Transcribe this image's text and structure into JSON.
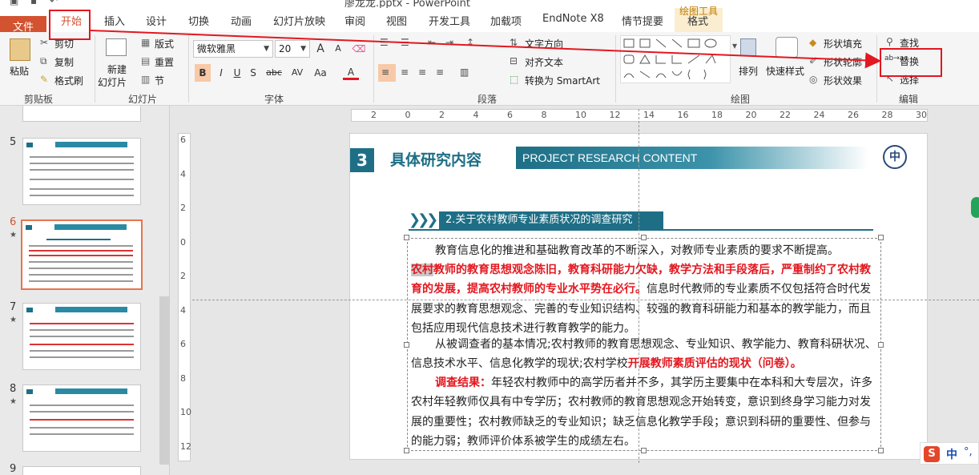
{
  "window": {
    "title": "廖龙龙.pptx - PowerPoint"
  },
  "tabs": {
    "file": "文件",
    "home": "开始",
    "insert": "插入",
    "design": "设计",
    "transitions": "切换",
    "animations": "动画",
    "slideshow": "幻灯片放映",
    "review": "审阅",
    "view": "视图",
    "developer": "开发工具",
    "addins": "加载项",
    "endnote": "EndNote X8",
    "storyboard": "情节提要",
    "format": "格式",
    "drawing_tools": "绘图工具"
  },
  "clipboard": {
    "paste": "粘贴",
    "cut": "剪切",
    "copy": "复制",
    "format_painter": "格式刷",
    "label": "剪贴板"
  },
  "slides": {
    "new_slide_1": "新建",
    "new_slide_2": "幻灯片",
    "layout": "版式",
    "reset": "重置",
    "section": "节",
    "label": "幻灯片"
  },
  "font": {
    "name": "微软雅黑",
    "size": "20",
    "label": "字体",
    "bold": "B",
    "italic": "I",
    "underline": "U",
    "shadow": "S",
    "strike": "abc",
    "spacing": "AV",
    "case": "Aa",
    "color": "A",
    "grow": "A",
    "shrink": "A"
  },
  "paragraph": {
    "text_direction": "文字方向",
    "align_text": "对齐文本",
    "smartart": "转换为 SmartArt",
    "label": "段落"
  },
  "drawing": {
    "arrange": "排列",
    "quick_styles": "快速样式",
    "shape_fill": "形状填充",
    "shape_outline": "形状轮廓",
    "shape_effects": "形状效果",
    "label": "绘图"
  },
  "editing": {
    "find": "查找",
    "replace": "替换",
    "select": "选择",
    "label": "编辑"
  },
  "thumbnails": [
    {
      "num": "5"
    },
    {
      "num": "6",
      "star": "★"
    },
    {
      "num": "7",
      "star": "★"
    },
    {
      "num": "8",
      "star": "★"
    },
    {
      "num": "9"
    }
  ],
  "ruler": {
    "h": [
      "2",
      "0",
      "2",
      "4",
      "6",
      "8",
      "10",
      "12",
      "14",
      "16",
      "18",
      "20",
      "22",
      "24",
      "26",
      "28",
      "30"
    ],
    "v": [
      "6",
      "4",
      "2",
      "0",
      "2",
      "4",
      "6",
      "8",
      "10",
      "12"
    ]
  },
  "slide": {
    "section_number": "3",
    "section_title": "具体研究内容",
    "band_text": "PROJECT RESEARCH CONTENT",
    "subhead": "2.关于农村教师专业素质状况的调查研究",
    "p1": "教育信息化的推进和基础教育改革的不断深入，对教师专业素质的要求不断提高。",
    "p2a_hl": "农村",
    "p2a_red": "教师的教育思想观念陈旧，教育科研能力欠缺，教学方法和手段落后，严重制约了农村教育的发展，提高农村教师的专业水平势在必行。",
    "p2b": "信息时代教师的专业素质不仅包括符合时代发展要求的教育思想观念、完善的专业知识结构、较强的教育科研能力和基本的教学能力，而且包括应用现代信息技术进行教育教学的能力。",
    "p3a": "从被调查者的基本情况;农村教师的教育思想观念、专业知识、教学能力、教育科研状况、信息技术水平、信息化教学的现状;农村学校",
    "p3b_red": "开展教师素质评估的现状（问卷）。",
    "p4_red": "调查结果：",
    "p4": "年轻农村教师中的高学历者并不多，其学历主要集中在本科和大专层次，许多农村年轻教师仅具有中专学历；农村教师的教育思想观念开始转变，意识到终身学习能力对发展的重要性；农村教师缺乏的专业知识；缺乏信息化教学手段；意识到科研的重要性、但参与的能力弱；教师评价体系被学生的成绩左右。"
  },
  "ime": {
    "label": "中"
  }
}
